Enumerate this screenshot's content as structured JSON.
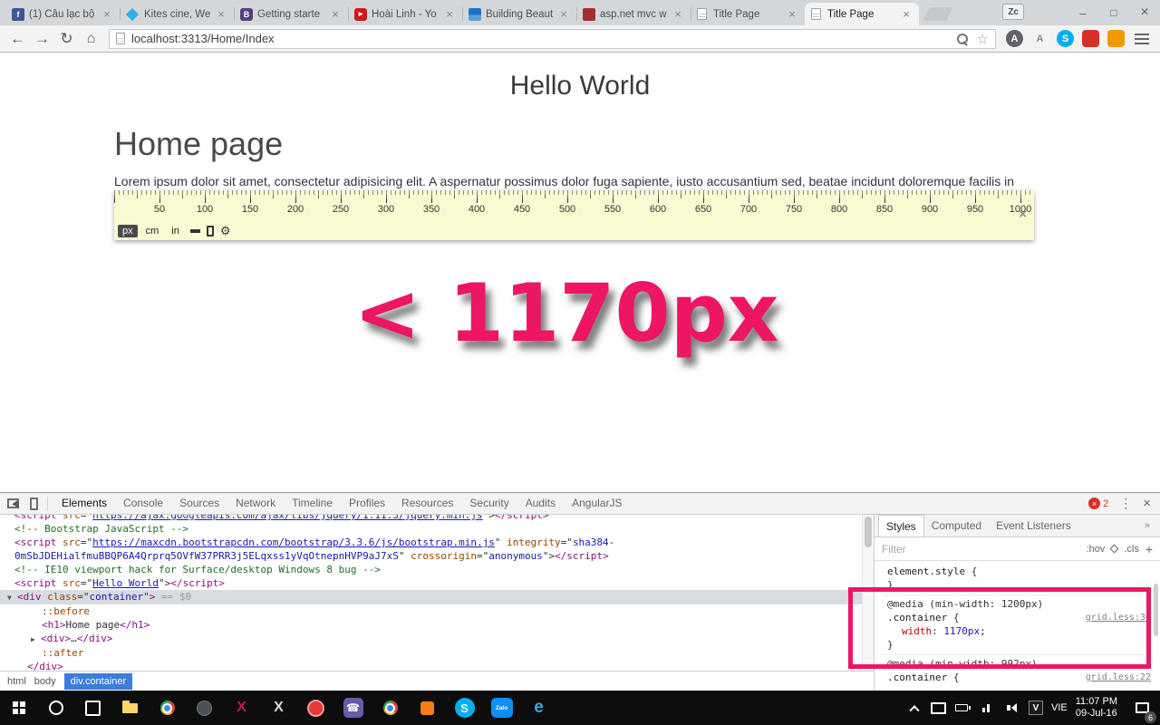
{
  "browser": {
    "tabs": [
      {
        "title": "(1) Câu lạc bộ",
        "fav": "facebook",
        "glyph": "f"
      },
      {
        "title": "Kites cine, We",
        "fav": "kites",
        "glyph": ""
      },
      {
        "title": "Getting starte",
        "fav": "bootstrap",
        "glyph": "B"
      },
      {
        "title": "Hoài Linh - Yo",
        "fav": "youtube",
        "glyph": "▶"
      },
      {
        "title": "Building Beaut",
        "fav": "building",
        "glyph": ""
      },
      {
        "title": "asp.net mvc w",
        "fav": "aspnet",
        "glyph": ""
      },
      {
        "title": "Title Page",
        "fav": "page",
        "glyph": ""
      },
      {
        "title": "Title Page",
        "fav": "page",
        "glyph": ""
      }
    ],
    "active_tab": 7,
    "profile_badge": "Zc",
    "url": "localhost:3313/Home/Index",
    "extensions": [
      {
        "name": "avim-extension",
        "letter": "A",
        "bg": "#5f6368",
        "shape": "circle"
      },
      {
        "name": "gray-a-extension",
        "letter": "A",
        "fg": "#8a8a8a",
        "shape": "circle"
      },
      {
        "name": "skype-extension",
        "letter": "S",
        "bg": "#00aff0",
        "shape": "circle"
      },
      {
        "name": "red-extension",
        "letter": "",
        "bg": "#d93025",
        "shape": "square"
      },
      {
        "name": "orange-extension",
        "letter": "",
        "bg": "#f29900",
        "shape": "square"
      }
    ]
  },
  "page": {
    "hello_title": "Hello World",
    "heading": "Home page",
    "lorem": "Lorem ipsum dolor sit amet, consectetur adipisicing elit. A aspernatur possimus dolor fuga sapiente, iusto accusantium sed, beatae incidunt doloremque facilis in perspiciatis neque iure libero assumenda sequi ea obcaecati.",
    "annotation_text": "< 1170px",
    "annotation_color": "#ec1664"
  },
  "ruler": {
    "numbers": [
      50,
      100,
      150,
      200,
      250,
      300,
      350,
      400,
      450,
      500,
      550,
      600,
      650,
      700,
      750,
      800,
      850,
      900,
      950,
      1000
    ],
    "units": [
      "px",
      "cm",
      "in"
    ],
    "selected_unit": "px"
  },
  "devtools": {
    "tabs": [
      "Elements",
      "Console",
      "Sources",
      "Network",
      "Timeline",
      "Profiles",
      "Resources",
      "Security",
      "Audits",
      "AngularJS"
    ],
    "selected_tab": 0,
    "error_count": "2",
    "dom_lines": [
      {
        "clip": true,
        "ind": 10,
        "segs": [
          [
            "tag",
            "<script "
          ],
          [
            "att",
            "src"
          ],
          [
            "pln",
            "=\""
          ],
          [
            "lnk",
            "https://ajax.googleapis.com/ajax/libs/jquery/1.11.3/jquery.min.js"
          ],
          [
            "pln",
            "\">"
          ],
          [
            "tag",
            "</script>"
          ]
        ]
      },
      {
        "ind": 10,
        "segs": [
          [
            "cmt",
            "<!-- Bootstrap JavaScript -->"
          ]
        ]
      },
      {
        "ind": 10,
        "segs": [
          [
            "tag",
            "<script "
          ],
          [
            "att",
            "src"
          ],
          [
            "pln",
            "=\""
          ],
          [
            "lnk",
            "https://maxcdn.bootstrapcdn.com/bootstrap/3.3.6/js/bootstrap.min.js"
          ],
          [
            "pln",
            "\" "
          ],
          [
            "att",
            "integrity"
          ],
          [
            "pln",
            "=\""
          ],
          [
            "val",
            "sha384-"
          ]
        ]
      },
      {
        "ind": 10,
        "segs": [
          [
            "val",
            "0mSbJDEHialfmuBBQP6A4Qrprq5OVfW37PRR3j5ELqxss1yVqOtnepnHVP9aJ7xS"
          ],
          [
            "pln",
            "\" "
          ],
          [
            "att",
            "crossorigin"
          ],
          [
            "pln",
            "=\""
          ],
          [
            "val",
            "anonymous"
          ],
          [
            "pln",
            "\">"
          ],
          [
            "tag",
            "</script>"
          ]
        ]
      },
      {
        "ind": 10,
        "segs": [
          [
            "cmt",
            "<!-- IE10 viewport hack for Surface/desktop Windows 8 bug -->"
          ]
        ]
      },
      {
        "ind": 10,
        "segs": [
          [
            "tag",
            "<script "
          ],
          [
            "att",
            "src"
          ],
          [
            "pln",
            "=\""
          ],
          [
            "lnk",
            "Hello World"
          ],
          [
            "pln",
            "\">"
          ],
          [
            "tag",
            "</script>"
          ]
        ]
      },
      {
        "sel": true,
        "ind": 2,
        "segs": [
          [
            "arr",
            "▼"
          ],
          [
            "tag",
            "<div"
          ],
          [
            "att",
            " class"
          ],
          [
            "pln",
            "=\""
          ],
          [
            "val",
            "container"
          ],
          [
            "pln",
            "\""
          ],
          [
            "tag",
            ">"
          ],
          [
            "gry",
            " == $0"
          ]
        ]
      },
      {
        "ind": 40,
        "segs": [
          [
            "psd",
            "::before"
          ]
        ]
      },
      {
        "ind": 40,
        "segs": [
          [
            "tag",
            "<h1>"
          ],
          [
            "pln",
            "Home page"
          ],
          [
            "tag",
            "</h1>"
          ]
        ]
      },
      {
        "ind": 28,
        "segs": [
          [
            "arr",
            "▶"
          ],
          [
            "tag",
            "<div>"
          ],
          [
            "pln",
            "…"
          ],
          [
            "tag",
            "</div>"
          ]
        ]
      },
      {
        "ind": 40,
        "segs": [
          [
            "psd",
            "::after"
          ]
        ]
      },
      {
        "ind": 24,
        "segs": [
          [
            "tag",
            "</div>"
          ]
        ]
      }
    ],
    "styles": {
      "tabs": [
        "Styles",
        "Computed",
        "Event Listeners"
      ],
      "selected_tab": 0,
      "filter_placeholder": "Filter",
      "toggle_hover": ":hov",
      "toggle_class": ".cls",
      "lines": [
        {
          "segs": [
            [
              "sel2",
              "element.style"
            ],
            [
              "pln",
              " {"
            ]
          ]
        },
        {
          "segs": [
            [
              "pln",
              "}"
            ]
          ]
        },
        {
          "sep": true,
          "segs": [
            [
              "med",
              "@media (min-width: 1200px)"
            ]
          ]
        },
        {
          "link": "grid.less:30",
          "segs": [
            [
              "sel2",
              ".container"
            ],
            [
              "pln",
              " {"
            ]
          ]
        },
        {
          "ind": 16,
          "segs": [
            [
              "prp",
              "width"
            ],
            [
              "pln",
              ": "
            ],
            [
              "num",
              "1170px"
            ],
            [
              "pln",
              ";"
            ]
          ]
        },
        {
          "segs": [
            [
              "pln",
              "}"
            ]
          ]
        },
        {
          "sep": true,
          "segs": [
            [
              "med",
              "@media (min-width: 992px)"
            ]
          ]
        },
        {
          "link": "grid.less:22",
          "segs": [
            [
              "sel2",
              ".container"
            ],
            [
              "pln",
              " {"
            ]
          ]
        }
      ]
    },
    "crumbs": [
      "html",
      "body",
      "div.container"
    ],
    "selected_crumb": "div.container"
  },
  "taskbar": {
    "icons": [
      {
        "name": "start"
      },
      {
        "name": "search"
      },
      {
        "name": "task-view"
      },
      {
        "name": "file-explorer"
      },
      {
        "name": "chrome"
      },
      {
        "name": "dark-app"
      },
      {
        "name": "x-app",
        "letter": "X"
      },
      {
        "name": "x2-app",
        "letter": "X"
      },
      {
        "name": "red-app"
      },
      {
        "name": "viber",
        "letter": "☎"
      },
      {
        "name": "chrome2"
      },
      {
        "name": "orange-app"
      },
      {
        "name": "skype",
        "letter": "S"
      },
      {
        "name": "zalo",
        "letter": "Zalo"
      },
      {
        "name": "edge",
        "letter": "e"
      }
    ],
    "tray_icons": [
      {
        "name": "tray-expand"
      },
      {
        "name": "display"
      },
      {
        "name": "battery"
      },
      {
        "name": "network"
      },
      {
        "name": "volume"
      },
      {
        "name": "unikey",
        "letter": "V"
      }
    ],
    "lang": "VIE",
    "time": "11:07 PM",
    "date": "09-Jul-16",
    "badge": "6"
  }
}
